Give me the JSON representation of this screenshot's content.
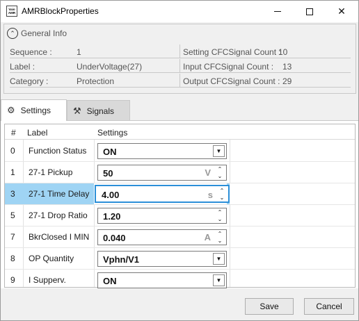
{
  "window": {
    "title": "AMRBlockProperties",
    "app_icon_text": "Vaio AMR",
    "controls": {
      "minimize": "minimize-icon",
      "maximize": "maximize-icon",
      "close": "close-icon"
    },
    "close_glyph": "✕"
  },
  "general_info": {
    "title": "General Info",
    "collapse_glyph": "⌃",
    "rows": [
      {
        "key": "Sequence :",
        "value": "1",
        "key2": "Setting CFCSignal Count :",
        "value2": "10"
      },
      {
        "key": "Label :",
        "value": "UnderVoltage(27)",
        "key2": "Input CFCSignal Count :",
        "value2": "13"
      },
      {
        "key": "Category :",
        "value": "Protection",
        "key2": "Output CFCSignal Count :",
        "value2": "29"
      }
    ]
  },
  "tabs": [
    {
      "label": "Settings",
      "icon": "gear-icon",
      "glyph": "⚙",
      "active": true
    },
    {
      "label": "Signals",
      "icon": "tools-icon",
      "glyph": "⚒",
      "active": false
    }
  ],
  "grid": {
    "columns": [
      "#",
      "Label",
      "Settings"
    ],
    "rows": [
      {
        "num": "0",
        "label": "Function Status",
        "value": "ON",
        "type": "combo",
        "unit": ""
      },
      {
        "num": "1",
        "label": "27-1 Pickup",
        "value": "50",
        "type": "spin",
        "unit": "V"
      },
      {
        "num": "3",
        "label": "27-1 Time Delay",
        "value": "4.00",
        "type": "spin",
        "unit": "s",
        "selected": true
      },
      {
        "num": "5",
        "label": "27-1 Drop Ratio",
        "value": "1.20",
        "type": "spin",
        "unit": ""
      },
      {
        "num": "7",
        "label": "BkrClosed I MIN",
        "value": "0.040",
        "type": "spin",
        "unit": "A"
      },
      {
        "num": "8",
        "label": "OP Quantity",
        "value": "Vphn/V1",
        "type": "combo",
        "unit": ""
      },
      {
        "num": "9",
        "label": "I Supperv.",
        "value": "ON",
        "type": "combo",
        "unit": ""
      }
    ]
  },
  "glyphs": {
    "combo": "▼",
    "spin_up": "⌃",
    "spin_down": "⌄"
  },
  "buttons": {
    "save": "Save",
    "cancel": "Cancel"
  }
}
